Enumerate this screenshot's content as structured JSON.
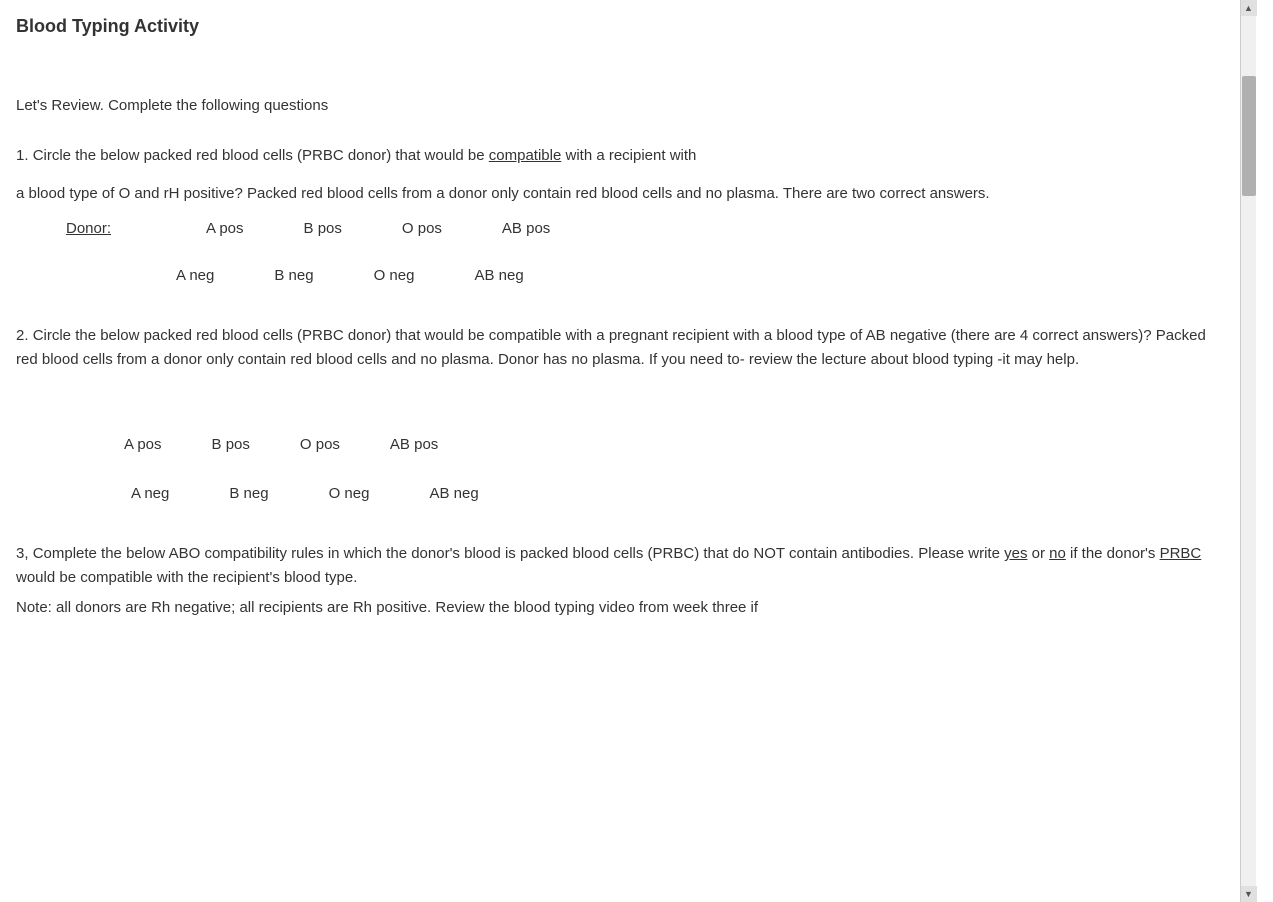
{
  "page": {
    "title": "Blood Typing Activity"
  },
  "intro": {
    "text": "Let's Review.  Complete the following questions"
  },
  "question1": {
    "number": "1.",
    "text_before_underline": "Circle the below packed red blood cells (PRBC donor) that would be ",
    "underline_word": "compatible",
    "text_after_underline": " with a recipient with",
    "continuation": "a blood type of O and rH positive?  Packed red blood cells from a donor only contain red blood cells and no plasma. There are two correct answers.",
    "donor_label": "Donor: ",
    "row1": {
      "options": [
        "A pos",
        "B pos",
        "O pos",
        "AB pos"
      ]
    },
    "row2": {
      "options": [
        "A neg",
        "B neg",
        "O neg",
        "AB neg"
      ]
    }
  },
  "question2": {
    "number": "2.",
    "text": "Circle the below packed red blood cells (PRBC donor) that would be compatible with a pregnant recipient with a blood type of AB negative (there are 4 correct answers)? Packed red blood cells from a donor only contain red blood cells and no plasma. Donor has no plasma. If you need to- review the lecture about blood typing -it may help.",
    "row1": {
      "options": [
        "A pos",
        "B pos",
        "O pos",
        "AB pos"
      ]
    },
    "row2": {
      "options": [
        "A neg",
        "B neg",
        "O neg",
        "AB neg"
      ]
    }
  },
  "question3": {
    "number": "3,",
    "text_part1": "Complete the below ABO compatibility rules in which the donor's blood is packed blood cells (PRBC) that do NOT contain antibodies.   Please write ",
    "yes_underline": "yes",
    "text_or": " or ",
    "no_underline": "no",
    "text_part2": " if the donor's ",
    "prbc_underline": "PRBC",
    "text_part3": " would be compatible with the recipient's blood type.",
    "note_text": "Note: all donors are Rh negative; all recipients are Rh positive. Review the blood typing video from week three if"
  },
  "scrollbar": {
    "up_arrow": "▲",
    "down_arrow": "▼"
  }
}
